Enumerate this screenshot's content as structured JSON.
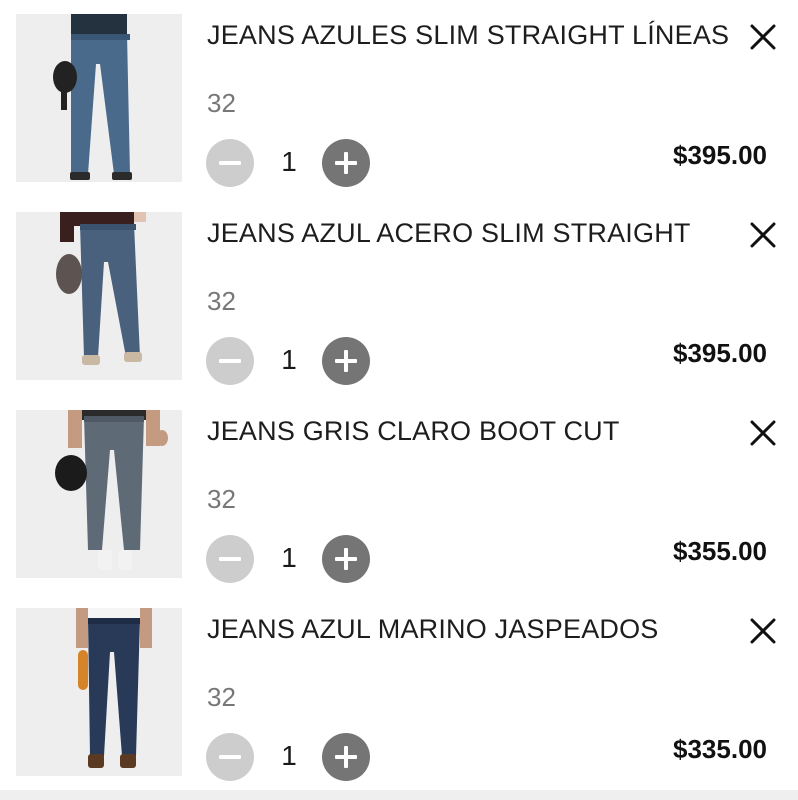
{
  "cart": {
    "items": [
      {
        "name": "JEANS AZULES SLIM STRAIGHT LÍNEAS",
        "size": "32",
        "quantity": "1",
        "price": "$395.00",
        "image_colors": {
          "jeans": "#4a6a8c",
          "top": "#24313f",
          "shoes": "#2b2b2b",
          "accessory": "#222222"
        }
      },
      {
        "name": "JEANS AZUL ACERO SLIM STRAIGHT",
        "size": "32",
        "quantity": "1",
        "price": "$395.00",
        "image_colors": {
          "jeans": "#49617c",
          "top": "#3a1f1f",
          "shoes": "#c9b9a3",
          "accessory": "#5d5350"
        }
      },
      {
        "name": "JEANS GRIS CLARO BOOT CUT",
        "size": "32",
        "quantity": "1",
        "price": "$355.00",
        "image_colors": {
          "jeans": "#5e6a76",
          "top": "#2b2b2b",
          "shoes": "#f2f2f2",
          "accessory": "#1b1b1b"
        }
      },
      {
        "name": "JEANS AZUL MARINO JASPEADOS",
        "size": "32",
        "quantity": "1",
        "price": "$335.00",
        "image_colors": {
          "jeans": "#283a57",
          "top": "#f5f5f5",
          "shoes": "#5a3a22",
          "accessory": "#d6842a"
        }
      }
    ]
  },
  "icons": {
    "remove": "close-icon",
    "decrease": "minus-icon",
    "increase": "plus-icon"
  },
  "colors": {
    "minus_button": "#cdcdcd",
    "plus_button": "#757575",
    "text": "#1d1d1d",
    "size_text": "#777777"
  }
}
